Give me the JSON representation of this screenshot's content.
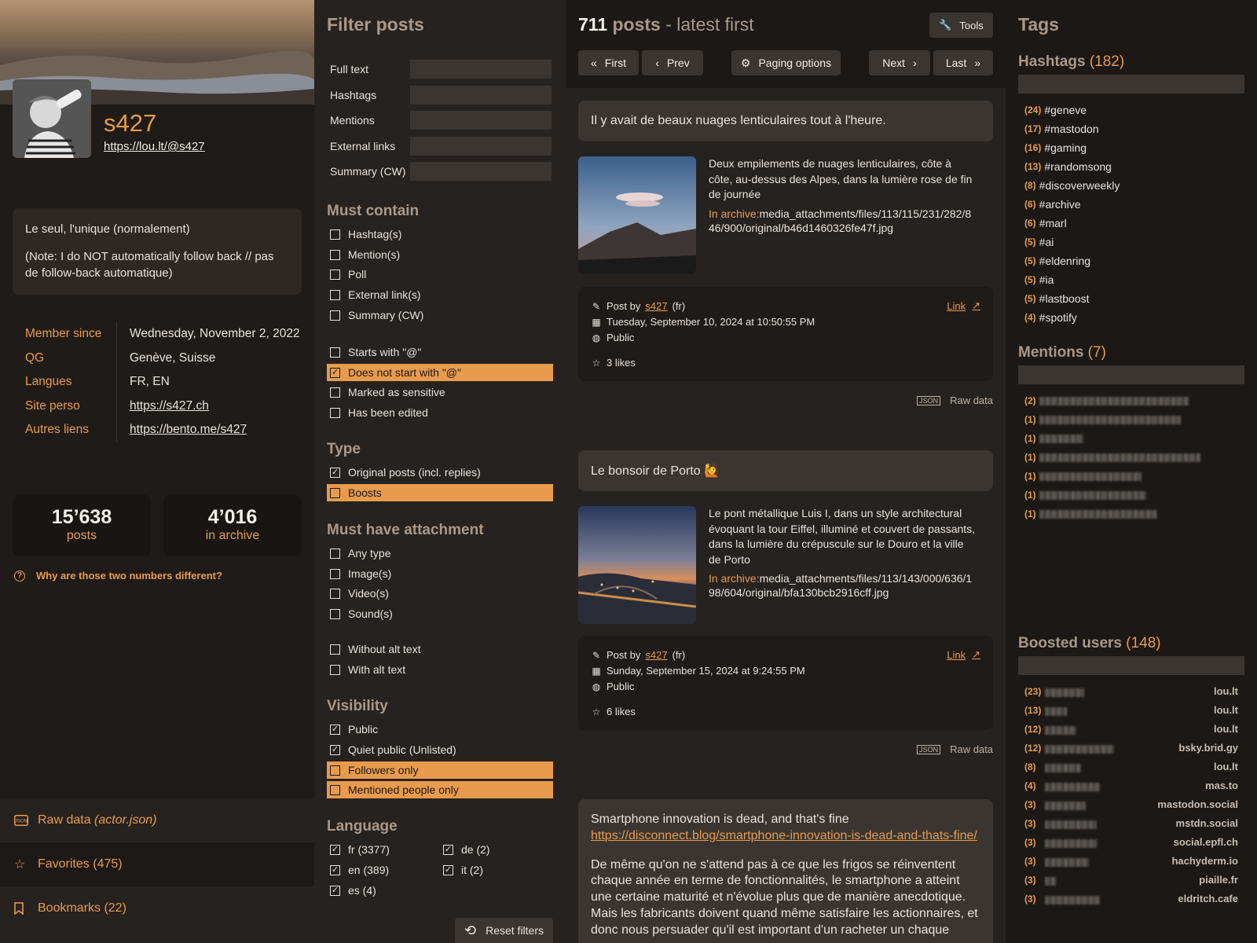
{
  "profile": {
    "username": "s427",
    "url": "https://lou.lt/@s427",
    "bio": [
      "Le seul, l'unique (normalement)",
      "(Note: I do NOT automatically follow back // pas de follow-back automatique)"
    ],
    "fields": [
      {
        "key": "Member since",
        "value": "Wednesday, November 2, 2022"
      },
      {
        "key": "QG",
        "value": "Genève, Suisse"
      },
      {
        "key": "Langues",
        "value": "FR, EN"
      },
      {
        "key": "Site perso",
        "value": "https://s427.ch"
      },
      {
        "key": "Autres liens",
        "value": "https://bento.me/s427"
      }
    ],
    "stats": [
      {
        "number": "15’638",
        "label": "posts"
      },
      {
        "number": "4’016",
        "label": "in archive"
      }
    ],
    "why_label": "Why are those two numbers different?",
    "nav": {
      "raw_data": "Raw data",
      "raw_data_file": "(actor.json)",
      "favorites": "Favorites (475)",
      "bookmarks": "Bookmarks (22)"
    }
  },
  "filters": {
    "title": "Filter posts",
    "text_fields": [
      "Full text",
      "Hashtags",
      "Mentions",
      "External links",
      "Summary (CW)"
    ],
    "must_contain": {
      "title": "Must contain",
      "items": [
        {
          "label": "Hashtag(s)",
          "checked": false
        },
        {
          "label": "Mention(s)",
          "checked": false
        },
        {
          "label": "Poll",
          "checked": false
        },
        {
          "label": "External link(s)",
          "checked": false
        },
        {
          "label": "Summary (CW)",
          "checked": false
        },
        {
          "label": "Starts with \"@\"",
          "checked": false
        },
        {
          "label": "Does not start with \"@\"",
          "checked": true
        },
        {
          "label": "Marked as sensitive",
          "checked": false
        },
        {
          "label": "Has been edited",
          "checked": false
        }
      ]
    },
    "type": {
      "title": "Type",
      "items": [
        {
          "label": "Original posts (incl. replies)",
          "checked": true
        },
        {
          "label": "Boosts",
          "checked": false
        }
      ]
    },
    "attachment": {
      "title": "Must have attachment",
      "items": [
        {
          "label": "Any type",
          "checked": false
        },
        {
          "label": "Image(s)",
          "checked": false
        },
        {
          "label": "Video(s)",
          "checked": false
        },
        {
          "label": "Sound(s)",
          "checked": false
        },
        {
          "label": "Without alt text",
          "checked": false
        },
        {
          "label": "With alt text",
          "checked": false
        }
      ]
    },
    "visibility": {
      "title": "Visibility",
      "items": [
        {
          "label": "Public",
          "checked": true
        },
        {
          "label": "Quiet public (Unlisted)",
          "checked": true
        },
        {
          "label": "Followers only",
          "checked": false
        },
        {
          "label": "Mentioned people only",
          "checked": false
        }
      ]
    },
    "language": {
      "title": "Language",
      "items": [
        {
          "label": "fr (3377)",
          "checked": true
        },
        {
          "label": "de (2)",
          "checked": true
        },
        {
          "label": "en (389)",
          "checked": true
        },
        {
          "label": "it (2)",
          "checked": true
        },
        {
          "label": "es (4)",
          "checked": true
        }
      ]
    },
    "reset_label": "Reset filters"
  },
  "posts": {
    "count": "711",
    "count_word": "posts",
    "order": "- latest first",
    "tools_label": "Tools",
    "paging": {
      "first": "First",
      "prev": "Prev",
      "options": "Paging options",
      "next": "Next",
      "last": "Last"
    },
    "items": [
      {
        "text": "Il y avait de beaux nuages lenticulaires tout à l'heure.",
        "alt": "Deux empilements de nuages lenticulaires, côte à côte, au-dessus des Alpes, dans la lumière rose de fin de journée",
        "archive_label": "In archive:",
        "archive_path": "media_attachments/files/113/115/231/282/846/900/original/b46d1460326fe47f.jpg",
        "post_by": "Post by",
        "author": "s427",
        "lang": "(fr)",
        "date": "Tuesday, September 10, 2024 at 10:50:55 PM",
        "visibility": "Public",
        "likes": "3 likes",
        "link_label": "Link",
        "raw_label": "Raw data"
      },
      {
        "text": "Le bonsoir de Porto 🙋",
        "alt": "Le pont métallique Luis I, dans un style architectural évoquant la tour Eiffel, illuminé et couvert de passants, dans la lumière du crépuscule sur le Douro et la ville de Porto",
        "archive_label": "In archive:",
        "archive_path": "media_attachments/files/113/143/000/636/198/604/original/bfa130bcb2916cff.jpg",
        "post_by": "Post by",
        "author": "s427",
        "lang": "(fr)",
        "date": "Sunday, September 15, 2024 at 9:24:55 PM",
        "visibility": "Public",
        "likes": "6 likes",
        "link_label": "Link",
        "raw_label": "Raw data"
      },
      {
        "text": "Smartphone innovation is dead, and that's fine",
        "link": "https://disconnect.blog/smartphone-innovation-is-dead-and-thats-fine/",
        "body": "De même qu'on ne s'attend pas à ce que les frigos se réinventent chaque année en terme de fonctionnalités, le smartphone a atteint une certaine maturité et n'évolue plus que de manière anecdotique. Mais les fabricants doivent quand même satisfaire les actionnaires, et donc nous persuader qu'il est important d'un racheter un chaque"
      }
    ]
  },
  "tags": {
    "title": "Tags",
    "hashtags": {
      "title": "Hashtags",
      "count": "(182)",
      "items": [
        {
          "count": "(24)",
          "tag": "#geneve"
        },
        {
          "count": "(17)",
          "tag": "#mastodon"
        },
        {
          "count": "(16)",
          "tag": "#gaming"
        },
        {
          "count": "(13)",
          "tag": "#randomsong"
        },
        {
          "count": "(8)",
          "tag": "#discoverweekly"
        },
        {
          "count": "(6)",
          "tag": "#archive"
        },
        {
          "count": "(6)",
          "tag": "#marl"
        },
        {
          "count": "(5)",
          "tag": "#ai"
        },
        {
          "count": "(5)",
          "tag": "#eldenring"
        },
        {
          "count": "(5)",
          "tag": "#ia"
        },
        {
          "count": "(5)",
          "tag": "#lastboost"
        },
        {
          "count": "(4)",
          "tag": "#spotify"
        }
      ]
    },
    "mentions": {
      "title": "Mentions",
      "count": "(7)",
      "items": [
        "(2)",
        "(1)",
        "(1)",
        "(1)",
        "(1)",
        "(1)",
        "(1)"
      ]
    },
    "boosted": {
      "title": "Boosted users",
      "count": "(148)",
      "items": [
        {
          "count": "(23)",
          "instance": "lou.lt"
        },
        {
          "count": "(13)",
          "instance": "lou.lt"
        },
        {
          "count": "(12)",
          "instance": "lou.lt"
        },
        {
          "count": "(12)",
          "instance": "bsky.brid.gy"
        },
        {
          "count": "(8)",
          "instance": "lou.lt"
        },
        {
          "count": "(4)",
          "instance": "mas.to"
        },
        {
          "count": "(3)",
          "instance": "mastodon.social"
        },
        {
          "count": "(3)",
          "instance": "mstdn.social"
        },
        {
          "count": "(3)",
          "instance": "social.epfl.ch"
        },
        {
          "count": "(3)",
          "instance": "hachyderm.io"
        },
        {
          "count": "(3)",
          "instance": "piaille.fr"
        },
        {
          "count": "(3)",
          "instance": "eldritch.cafe"
        }
      ]
    }
  }
}
